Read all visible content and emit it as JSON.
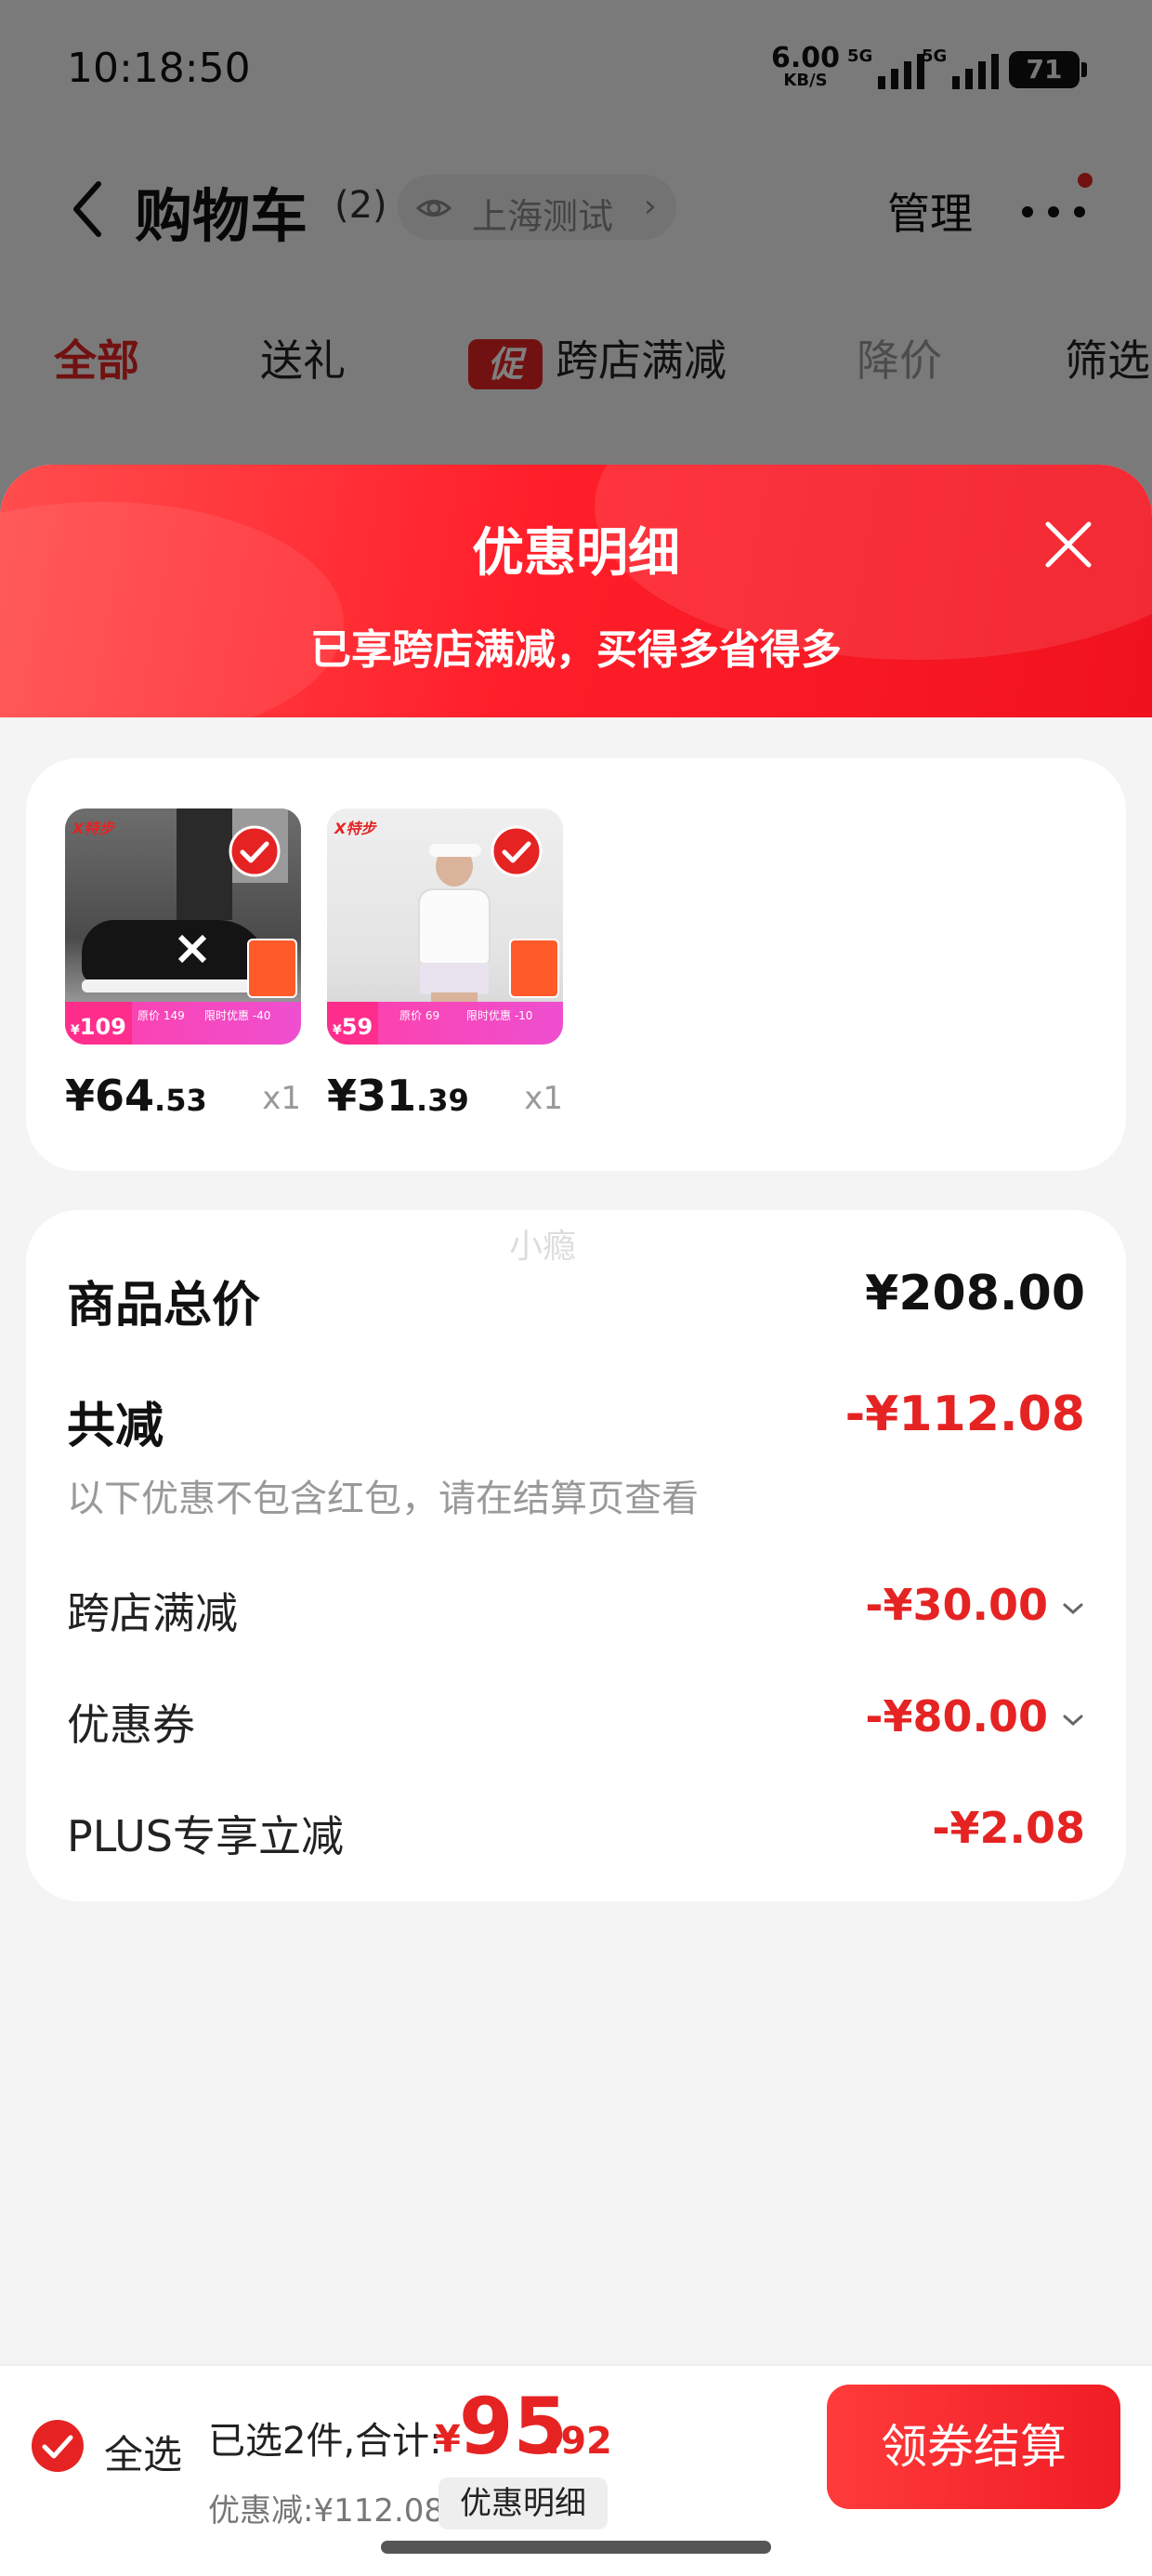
{
  "status_bar": {
    "time": "10:18:50",
    "net_speed": "6.00",
    "net_unit": "KB/S",
    "signal1_label": "5G",
    "signal2_label": "5G",
    "battery": "71"
  },
  "nav": {
    "title": "购物车",
    "count": "(2)",
    "location": "上海测试",
    "location_chevron": "›",
    "manage": "管理"
  },
  "tabs": [
    {
      "label": "全部"
    },
    {
      "label": "送礼"
    },
    {
      "label": "跨店满减",
      "badge": "促"
    },
    {
      "label": "降价"
    },
    {
      "label": "筛选"
    }
  ],
  "sheet": {
    "title": "优惠明细",
    "subtitle": "已享跨店满减，买得多省得多"
  },
  "products": [
    {
      "brand": "X",
      "brand_suffix": "特步",
      "strip_price": "109",
      "strip_text_a": "原价 149",
      "strip_text_b": "限时优惠 -40",
      "price_yen": "¥",
      "price_int": "64",
      "price_dec": ".53",
      "qty": "x1"
    },
    {
      "brand": "X",
      "brand_suffix": "特步",
      "strip_price": "59",
      "strip_text_a": "原价 69",
      "strip_text_b": "限时优惠 -10",
      "price_yen": "¥",
      "price_int": "31",
      "price_dec": ".39",
      "qty": "x1"
    }
  ],
  "summary": {
    "watermark": "小瘾",
    "total_label": "商品总价",
    "total_value": "¥208.00",
    "reduce_label": "共减",
    "reduce_value": "-¥112.08",
    "note": "以下优惠不包含红包，请在结算页查看",
    "items": [
      {
        "label": "跨店满减",
        "value": "-¥30.00"
      },
      {
        "label": "优惠券",
        "value": "-¥80.00"
      },
      {
        "label": "PLUS专享立减",
        "value": "-¥2.08"
      }
    ]
  },
  "checkout": {
    "select_all": "全选",
    "selected_text": "已选2件,合计:",
    "total_yen": "¥",
    "total_int": "95",
    "total_dec": ".92",
    "saved_text": "优惠减:¥112.08",
    "detail_chip": "优惠明细",
    "button": "领券结算"
  },
  "colors": {
    "accent": "#e52323",
    "header_gradient_start": "#ff4d4d",
    "header_gradient_end": "#f0121e"
  }
}
